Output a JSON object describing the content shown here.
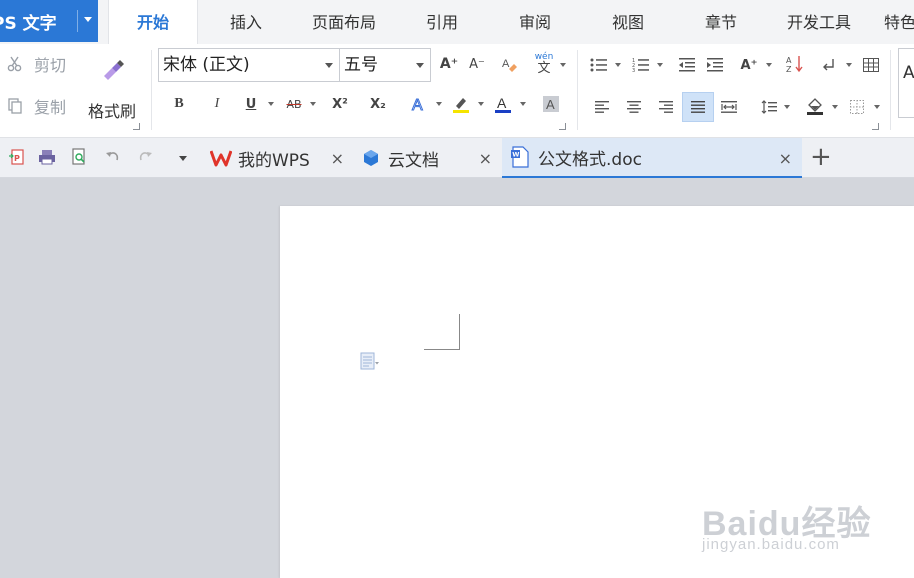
{
  "app": {
    "title": "PS 文字",
    "brand_color": "#2b78d6"
  },
  "menu": {
    "tabs": [
      {
        "label": "开始",
        "active": true
      },
      {
        "label": "插入"
      },
      {
        "label": "页面布局"
      },
      {
        "label": "引用"
      },
      {
        "label": "审阅"
      },
      {
        "label": "视图"
      },
      {
        "label": "章节"
      },
      {
        "label": "开发工具"
      },
      {
        "label": "特色"
      }
    ]
  },
  "ribbon": {
    "clipboard": {
      "cut_label": "剪切",
      "copy_label": "复制",
      "format_painter_label": "格式刷"
    },
    "font": {
      "family_value": "宋体 (正文)",
      "size_value": "五号",
      "bold_glyph": "B",
      "italic_glyph": "I",
      "underline_glyph": "U",
      "strike_glyph": "AB",
      "superscript_glyph": "X²",
      "subscript_glyph": "X₂",
      "grow_glyph": "A⁺",
      "shrink_glyph": "A⁻",
      "phonetic_glyph": "wén",
      "phonetic_char": "文",
      "font_color": "#1a3fc4",
      "highlight_color": "#f5e400"
    },
    "style_preview": "A"
  },
  "tabbar": {
    "tabs": [
      {
        "label": "我的WPS",
        "icon": "wps-logo-icon"
      },
      {
        "label": "云文档",
        "icon": "cloud-doc-icon"
      },
      {
        "label": "公文格式.doc",
        "icon": "word-doc-icon",
        "active": true
      }
    ],
    "close_glyph": "×",
    "new_tab_glyph": "+"
  },
  "watermark": {
    "brand": "Baidu经验",
    "sub": "jingyan.baidu.com"
  }
}
